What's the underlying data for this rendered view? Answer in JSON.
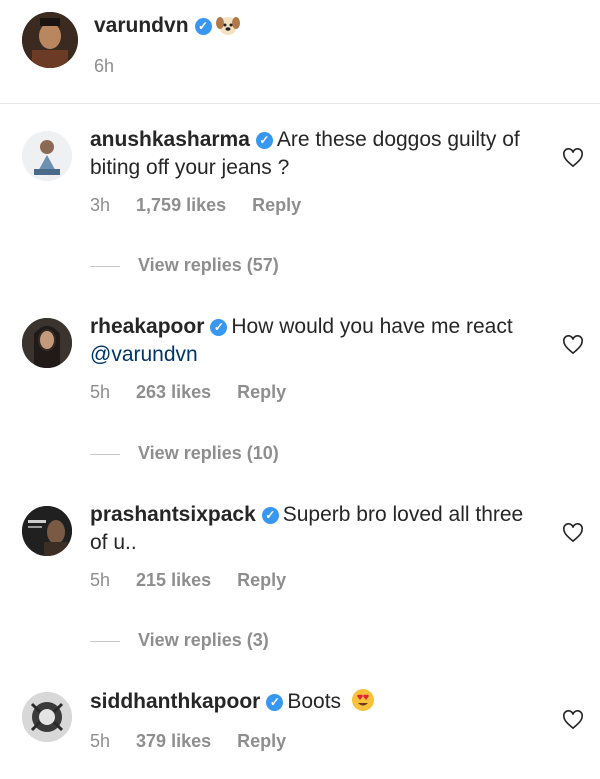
{
  "post": {
    "username": "varundvn",
    "time": "6h"
  },
  "comments": [
    {
      "username": "anushkasharma",
      "text": "Are these doggos guilty of biting off your jeans ?",
      "time": "3h",
      "likes": "1,759 likes",
      "reply": "Reply",
      "view_replies": "View replies (57)"
    },
    {
      "username": "rheakapoor",
      "text": "How would you have me react",
      "mention": "@varundvn",
      "time": "5h",
      "likes": "263 likes",
      "reply": "Reply",
      "view_replies": "View replies (10)"
    },
    {
      "username": "prashantsixpack",
      "text": "Superb bro loved all three of u..",
      "time": "5h",
      "likes": "215 likes",
      "reply": "Reply",
      "view_replies": "View replies (3)"
    },
    {
      "username": "siddhanthkapoor",
      "text": "Boots",
      "time": "5h",
      "likes": "379 likes",
      "reply": "Reply"
    }
  ],
  "icons": {
    "verified": "verified-badge-icon",
    "heart": "heart-outline-icon",
    "dog_emoji": "dog-face-emoji-icon",
    "heart_eyes_emoji": "heart-eyes-emoji-icon"
  },
  "colors": {
    "verified": "#3897f0",
    "meta": "#8e8e8e",
    "text": "#262626"
  }
}
